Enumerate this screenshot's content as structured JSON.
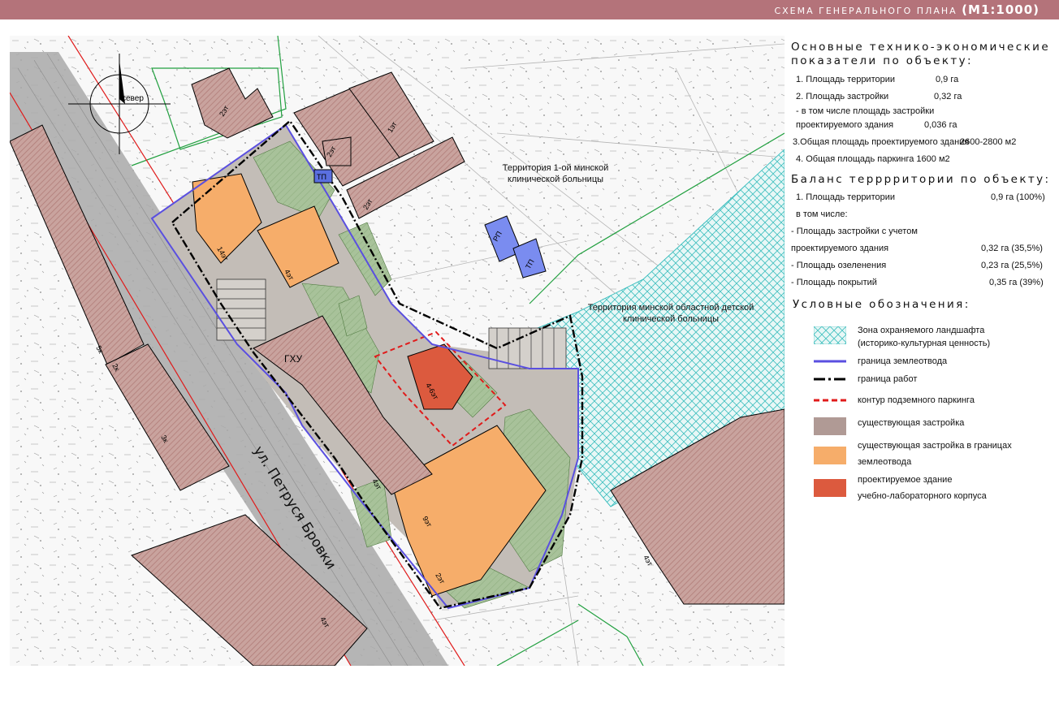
{
  "header": {
    "title": "СХЕМА ГЕНЕРАЛЬНОГО ПЛАНА",
    "scale": "(М1:1000)",
    "color": "#b4737a"
  },
  "map": {
    "north_label": "север",
    "street_label": "ул. Петруся Бровки",
    "hospital1_label": [
      "Территория 1-ой минской",
      "клинической больницы"
    ],
    "hospital2_label": [
      "Территория минской областной детской",
      "клинической больницы"
    ],
    "gkhu_label": "ГХУ",
    "tp_label": "ТП",
    "rp_label": "РП",
    "floors": {
      "f2_a": "2эт",
      "f2_b": "2эт",
      "f2_c": "2эт",
      "f1": "1эт",
      "f14": "14эт",
      "f4_a": "4эт",
      "f4_6": "4-6эт",
      "f4_b": "4эт",
      "f9": "9эт",
      "f2_d": "2эт",
      "f4_c": "4эт",
      "f4_d": "4эт",
      "f5k": "5к",
      "f2k": "2к",
      "f3k": "3к"
    }
  },
  "indicators": {
    "heading": [
      "Основные технико-экономические",
      "показатели по объекту:"
    ],
    "items": [
      {
        "label": "1. Площадь территории",
        "value": "0,9 га"
      },
      {
        "label": "2. Площадь застройки",
        "value": "0,32 га"
      },
      {
        "label": " - в том числе площадь застройки",
        "value": ""
      },
      {
        "label": "   проектируемого здания",
        "value": "0,036 га"
      },
      {
        "label": "3.Общая площадь проектируемого здания",
        "value": "2600-2800 м2"
      },
      {
        "label": "4. Общая площадь паркинга 1600 м2",
        "value": ""
      }
    ]
  },
  "balance": {
    "heading": "Баланс терррритории по объекту:",
    "items": [
      {
        "label": "1. Площадь территории",
        "value": "0,9 га (100%)"
      },
      {
        "label": "     в том числе:",
        "value": ""
      },
      {
        "label": "-  Площадь застройки с учетом",
        "value": ""
      },
      {
        "label": "   проектируемого здания",
        "value": "0,32 га (35,5%)"
      },
      {
        "label": "-   Площадь озеленения",
        "value": "0,23 га (25,5%)"
      },
      {
        "label": "-   Площадь покрытий",
        "value": "0,35 га  (39%)"
      }
    ]
  },
  "legend": {
    "heading": "Условные обозначения:",
    "items": [
      {
        "icon": "hatch-swatch",
        "lines": [
          "Зона охраняемого ландшафта",
          "(историко-культурная ценность)"
        ],
        "color": "#3fbfbf"
      },
      {
        "icon": "blue-line",
        "lines": [
          "граница землеотвода"
        ],
        "color": "#5a4fe0"
      },
      {
        "icon": "dash-dot-line",
        "lines": [
          "граница работ"
        ],
        "color": "#000000"
      },
      {
        "icon": "red-dashed-line",
        "lines": [
          "контур подземного паркинга"
        ],
        "color": "#e01b1b"
      },
      {
        "icon": "brown-swatch",
        "lines": [
          "существующая застройка"
        ],
        "color": "#b09a95"
      },
      {
        "icon": "orange-swatch",
        "lines": [
          "существующая застройка в границах",
          "землеотвода"
        ],
        "color": "#f6ad6a"
      },
      {
        "icon": "red-swatch",
        "lines": [
          "проектируемое здание",
          "учебно-лабораторного корпуса"
        ],
        "color": "#dc5a3e"
      }
    ]
  }
}
